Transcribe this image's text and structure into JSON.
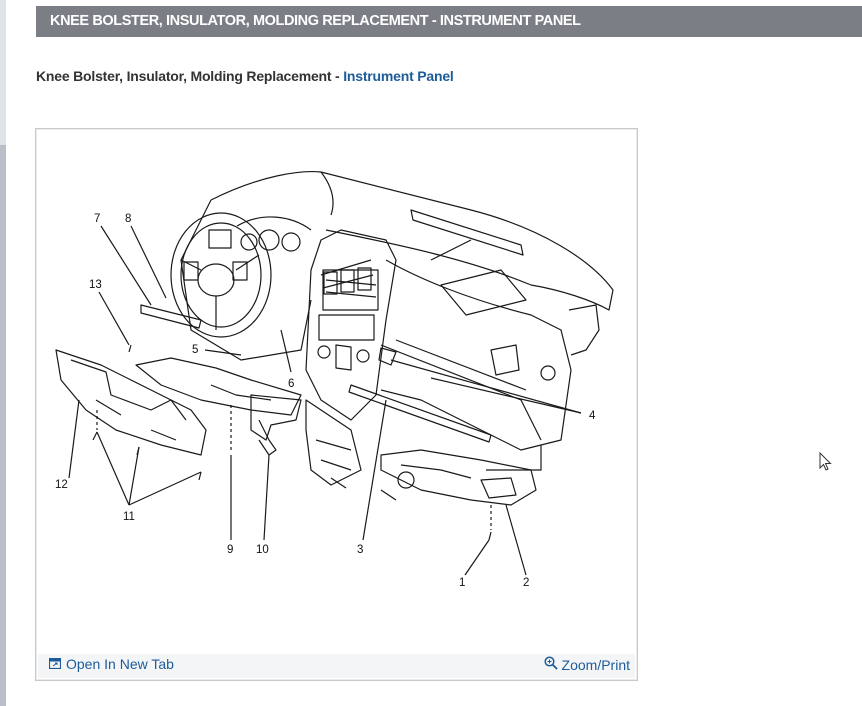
{
  "header": {
    "title": "KNEE BOLSTER, INSULATOR, MOLDING REPLACEMENT - INSTRUMENT PANEL"
  },
  "subtitle": {
    "prefix": "Knee Bolster, Insulator, Molding Replacement - ",
    "link": "Instrument Panel"
  },
  "figure": {
    "callouts": [
      "1",
      "2",
      "3",
      "4",
      "5",
      "6",
      "7",
      "8",
      "9",
      "10",
      "11",
      "12",
      "13"
    ],
    "open_tab_label": "Open In New Tab",
    "zoom_label": "Zoom/Print",
    "open_tab_icon": "open-tab-icon",
    "zoom_icon": "magnifier-icon"
  },
  "colors": {
    "header_bg": "#7b7f85",
    "link": "#1d5b9a"
  }
}
